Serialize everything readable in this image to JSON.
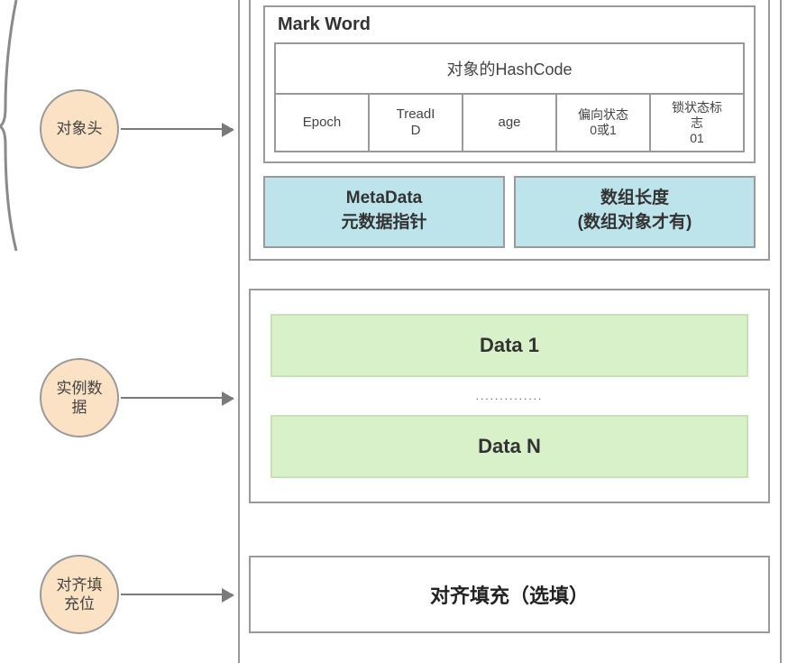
{
  "brace_visible": true,
  "circles": {
    "header": "对象头",
    "instance": "实例数\n据",
    "padding": "对齐填\n充位"
  },
  "markword": {
    "title": "Mark Word",
    "hashcode": "对象的HashCode",
    "cells": {
      "epoch": "Epoch",
      "thread": "TreadI\nD",
      "age": "age",
      "bias": "偏向状态\n0或1",
      "lock": "锁状态标\n志\n01"
    }
  },
  "meta": {
    "metadata": "MetaData\n元数据指针",
    "arraylen": "数组长度\n(数组对象才有)"
  },
  "data": {
    "first": "Data 1",
    "dots": "..............",
    "last": "Data N"
  },
  "padding_panel": "对齐填充（选填）"
}
